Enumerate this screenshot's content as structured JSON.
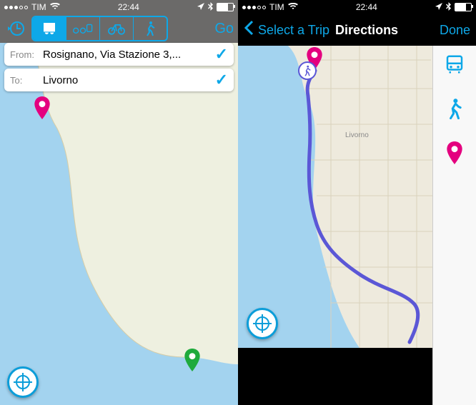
{
  "status": {
    "carrier": "TIM",
    "time": "22:44"
  },
  "screen1": {
    "go_label": "Go",
    "from_label": "From:",
    "from_value": "Rosignano, Via Stazione 3,...",
    "to_label": "To:",
    "to_value": "Livorno"
  },
  "screen2": {
    "back_label": "Select a Trip",
    "title": "Directions",
    "done_label": "Done",
    "city_label": "Livorno"
  }
}
